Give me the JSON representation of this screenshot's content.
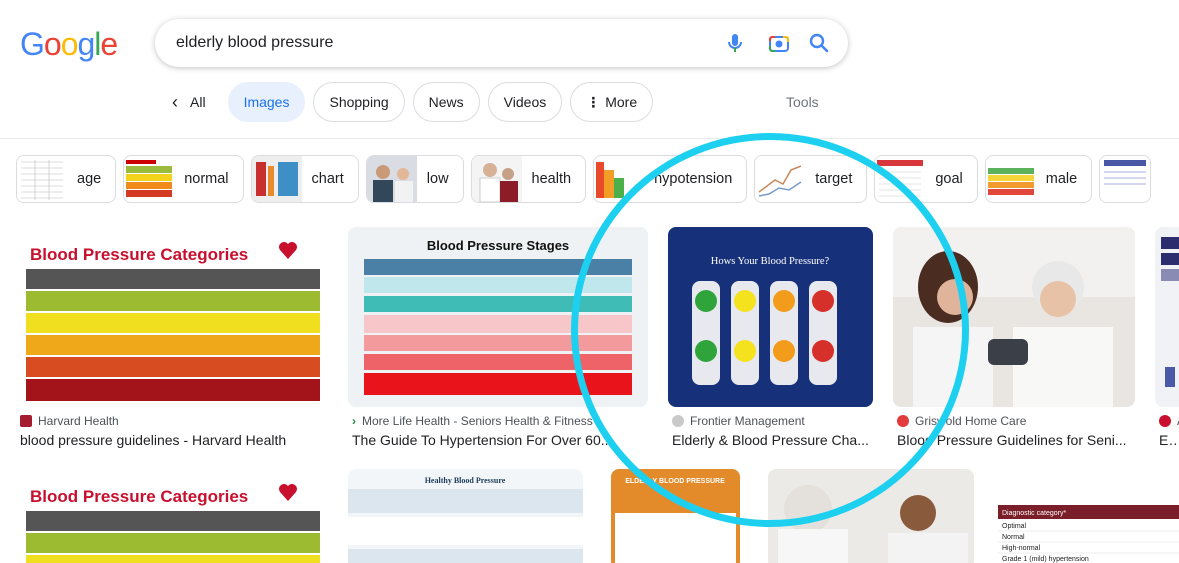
{
  "logo": {
    "letters": [
      "G",
      "o",
      "o",
      "g",
      "l",
      "e"
    ],
    "colors": [
      "#4285f4",
      "#ea4335",
      "#fbbc05",
      "#4285f4",
      "#34a853",
      "#ea4335"
    ]
  },
  "search": {
    "query": "elderly blood pressure"
  },
  "tabs": {
    "all": "All",
    "items": [
      "Images",
      "Shopping",
      "News",
      "Videos"
    ],
    "more": "More",
    "tools": "Tools"
  },
  "chips": [
    "age",
    "normal",
    "chart",
    "low",
    "health",
    "hypotension",
    "target",
    "goal",
    "male"
  ],
  "results": [
    {
      "source": "Harvard Health",
      "title": "blood pressure guidelines - Harvard Health",
      "image_title": "Blood Pressure Categories"
    },
    {
      "source": "More Life Health - Seniors Health & Fitness",
      "title": "The Guide To Hypertension For Over 60...",
      "image_title": "Blood Pressure Stages"
    },
    {
      "source": "Frontier Management",
      "title": "Elderly & Blood Pressure Cha...",
      "image_title": "Hows Your Blood Pressure?"
    },
    {
      "source": "Griswold Home Care",
      "title": "Blood Pressure Guidelines for Seni..."
    },
    {
      "source": "A",
      "title": "Exp"
    }
  ],
  "row2": [
    {
      "image_title": "Blood Pressure Categories"
    },
    {
      "image_title": "Healthy Blood Pressure"
    },
    {
      "image_title": "ELDERLY BLOOD PRESSURE"
    },
    {},
    {
      "image_title": "Diagnostic category*",
      "rows": [
        "Optimal",
        "Normal",
        "High-normal",
        "Grade 1 (mild) hypertension"
      ]
    }
  ],
  "colors": {
    "accent": "#1a73e8",
    "ring": "#1ed0f0"
  }
}
